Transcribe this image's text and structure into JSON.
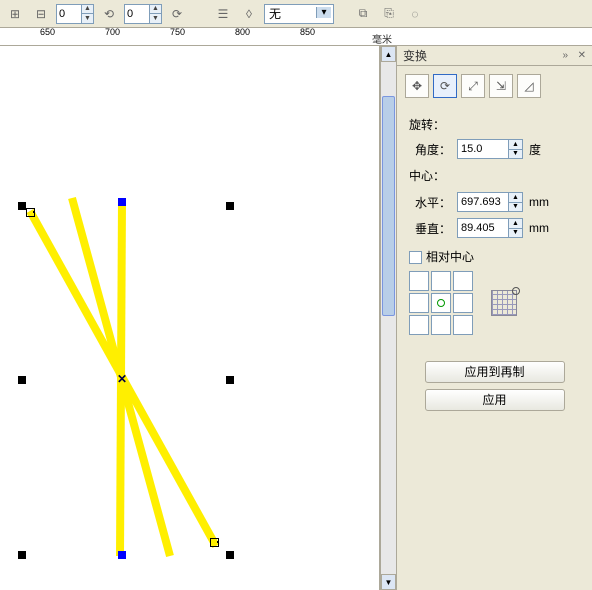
{
  "toolbar": {
    "spin1": "0",
    "spin2": "0",
    "fill_label": "无"
  },
  "ruler": {
    "ticks": [
      "650",
      "700",
      "750",
      "800",
      "850"
    ],
    "unit": "毫米"
  },
  "panel": {
    "title": "变换",
    "section_rotate": "旋转：",
    "angle_label": "角度：",
    "angle_value": "15.0",
    "angle_unit": "度",
    "section_center": "中心：",
    "horiz_label": "水平：",
    "horiz_value": "697.693",
    "vert_label": "垂直：",
    "vert_value": "89.405",
    "mm": "mm",
    "relative_center": "相对中心",
    "apply_dup": "应用到再制",
    "apply": "应用"
  }
}
